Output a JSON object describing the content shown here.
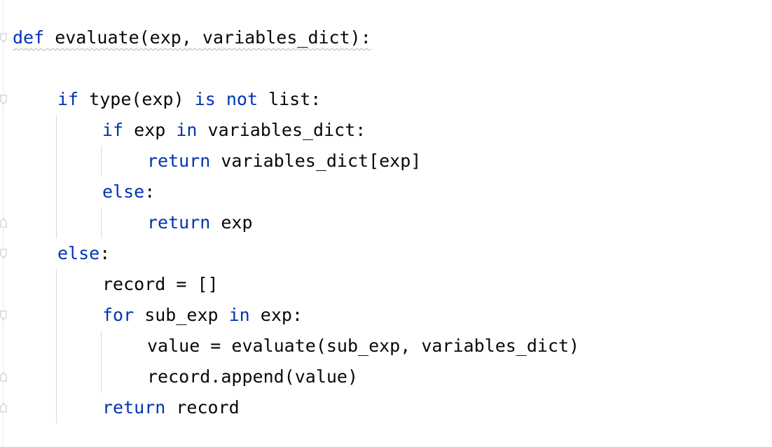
{
  "editor": {
    "language": "python",
    "colors": {
      "keyword": "#0033b3",
      "text": "#080808",
      "background": "#ffffff",
      "indent_guide": "#d8d8d8",
      "weak_warning_underline": "#b5b5b5"
    },
    "lines": [
      {
        "kw": "def",
        "text": " evaluate(exp, variables_dict):"
      },
      {},
      {
        "kw": "if",
        "text1": " type(exp) ",
        "kw2": "is",
        "sp": " ",
        "kw3": "not",
        "text2": " list:"
      },
      {
        "kw": "if",
        "text1": " exp ",
        "kw2": "in",
        "text2": " variables_dict:"
      },
      {
        "kw": "return",
        "text": " variables_dict[exp]"
      },
      {
        "kw": "else",
        "text": ":"
      },
      {
        "kw": "return",
        "text": " exp"
      },
      {
        "kw": "else",
        "text": ":"
      },
      {
        "text": "record = []"
      },
      {
        "kw": "for",
        "text1": " sub_exp ",
        "kw2": "in",
        "text2": " exp:"
      },
      {
        "text": "value = evaluate(sub_exp, variables_dict)"
      },
      {
        "text": "record.append(value)"
      },
      {
        "kw": "return",
        "text": " record"
      }
    ]
  }
}
